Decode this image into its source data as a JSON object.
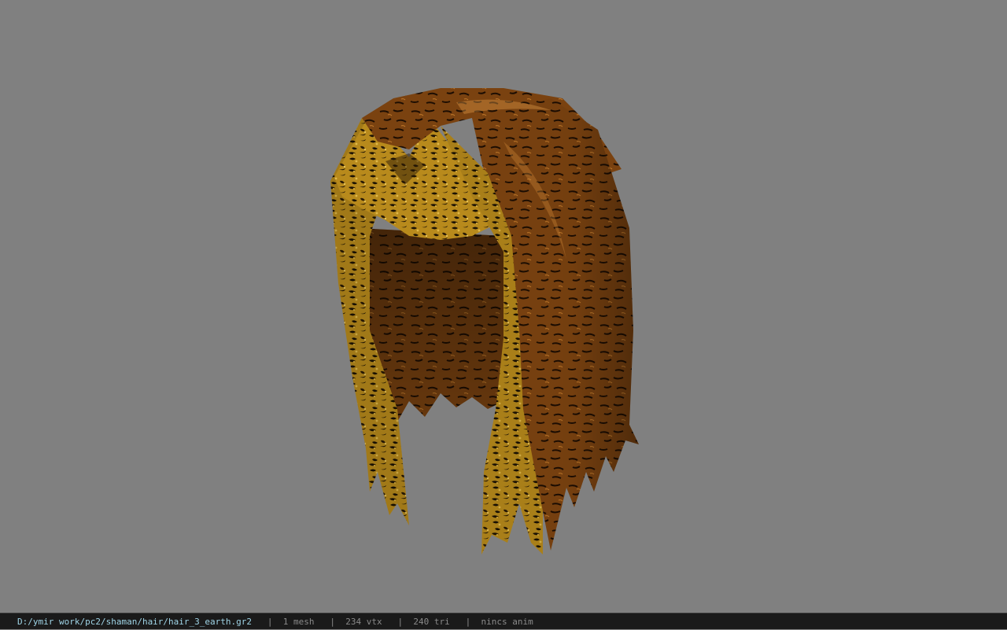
{
  "viewport": {
    "background": "#808080",
    "model_name": "hair-mesh"
  },
  "statusbar": {
    "path": "D:/ymir work/pc2/shaman/hair/hair_3_earth.gr2",
    "separator": "   |  ",
    "mesh_count": "1 mesh",
    "vertex_count": "234 vtx",
    "triangle_count": "240 tri",
    "animation": "nincs anim",
    "path_color": "#9fd4e6",
    "text_color": "#8a8a8a"
  }
}
